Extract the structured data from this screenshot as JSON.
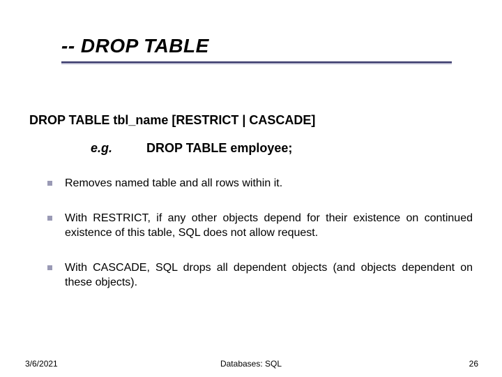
{
  "title": "-- DROP TABLE",
  "syntax": "DROP TABLE tbl_name [RESTRICT | CASCADE]",
  "example": {
    "label": "e.g.",
    "code": "DROP TABLE employee;"
  },
  "bullets": [
    "Removes named table and all rows within it.",
    "With RESTRICT, if any other objects depend for their existence on continued existence of this table, SQL does not allow request.",
    "With CASCADE, SQL drops all dependent objects (and objects dependent on these objects)."
  ],
  "footer": {
    "date": "3/6/2021",
    "center": "Databases: SQL",
    "page": "26"
  }
}
